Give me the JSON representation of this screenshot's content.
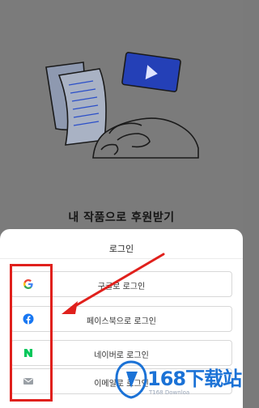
{
  "headline": "내 작품으로 후원받기",
  "sheet": {
    "title": "로그인",
    "buttons": [
      {
        "label": "구글로 로그인",
        "icon": "google-icon",
        "color": "#4285f4"
      },
      {
        "label": "페이스북으로 로그인",
        "icon": "facebook-icon",
        "color": "#1877f2"
      },
      {
        "label": "네이버로 로그인",
        "icon": "naver-icon",
        "color": "#03c75a"
      },
      {
        "label": "이메일로 로그인",
        "icon": "email-icon",
        "color": "#9aa0a6"
      }
    ]
  },
  "annotation": {
    "highlight_color": "#e0201c"
  },
  "watermark": {
    "main": "168下载站",
    "sub": "T168 Downloa"
  }
}
